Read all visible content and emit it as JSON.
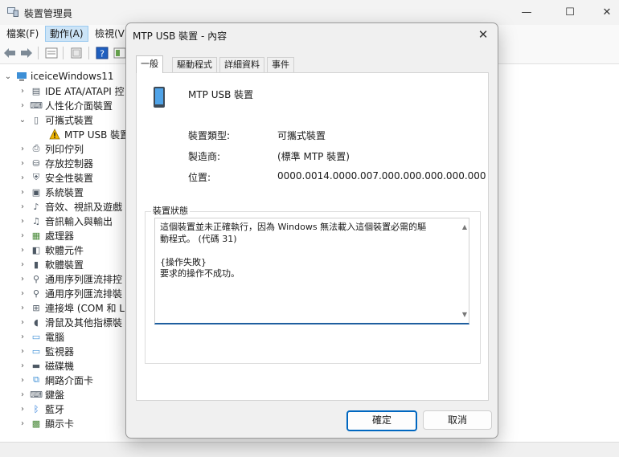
{
  "window": {
    "title": "裝置管理員",
    "controls": {
      "minimize": "—",
      "maximize": "☐",
      "close": "✕"
    }
  },
  "menu": [
    {
      "label": "檔案(F)",
      "active": false
    },
    {
      "label": "動作(A)",
      "active": true
    },
    {
      "label": "檢視(V)",
      "active": false
    }
  ],
  "toolbar": {
    "icons": [
      "back-arrow-icon",
      "forward-arrow-icon",
      "properties-icon",
      "update-icon",
      "help-icon",
      "show-hidden-icon"
    ]
  },
  "tree": {
    "root": "iceiceWindows11",
    "nodes": [
      {
        "label": "IDE ATA/ATAPI 控",
        "expanded": false,
        "icon": "ide-controller-icon"
      },
      {
        "label": "人性化介面裝置",
        "expanded": false,
        "icon": "hid-icon"
      },
      {
        "label": "可攜式裝置",
        "expanded": true,
        "icon": "portable-device-icon",
        "children": [
          {
            "label": "MTP USB 裝置",
            "warning": true
          }
        ]
      },
      {
        "label": "列印佇列",
        "expanded": false,
        "icon": "printer-icon"
      },
      {
        "label": "存放控制器",
        "expanded": false,
        "icon": "storage-controller-icon"
      },
      {
        "label": "安全性裝置",
        "expanded": false,
        "icon": "security-device-icon"
      },
      {
        "label": "系統裝置",
        "expanded": false,
        "icon": "system-device-icon"
      },
      {
        "label": "音效、視訊及遊戲",
        "expanded": false,
        "icon": "sound-icon"
      },
      {
        "label": "音訊輸入與輸出",
        "expanded": false,
        "icon": "audio-io-icon"
      },
      {
        "label": "處理器",
        "expanded": false,
        "icon": "processor-icon"
      },
      {
        "label": "軟體元件",
        "expanded": false,
        "icon": "software-component-icon"
      },
      {
        "label": "軟體裝置",
        "expanded": false,
        "icon": "software-device-icon"
      },
      {
        "label": "通用序列匯流排控",
        "expanded": false,
        "icon": "usb-controller-icon"
      },
      {
        "label": "通用序列匯流排裝",
        "expanded": false,
        "icon": "usb-device-icon"
      },
      {
        "label": "連接埠 (COM 和 L",
        "expanded": false,
        "icon": "port-icon"
      },
      {
        "label": "滑鼠及其他指標裝",
        "expanded": false,
        "icon": "mouse-icon"
      },
      {
        "label": "電腦",
        "expanded": false,
        "icon": "computer-icon"
      },
      {
        "label": "監視器",
        "expanded": false,
        "icon": "monitor-icon"
      },
      {
        "label": "磁碟機",
        "expanded": false,
        "icon": "disk-drive-icon"
      },
      {
        "label": "網路介面卡",
        "expanded": false,
        "icon": "network-adapter-icon"
      },
      {
        "label": "鍵盤",
        "expanded": false,
        "icon": "keyboard-icon"
      },
      {
        "label": "藍牙",
        "expanded": false,
        "icon": "bluetooth-icon"
      },
      {
        "label": "顯示卡",
        "expanded": false,
        "icon": "display-adapter-icon"
      }
    ]
  },
  "dialog": {
    "title": "MTP USB 裝置 - 內容",
    "close": "✕",
    "tabs": [
      "一般",
      "驅動程式",
      "詳細資料",
      "事件"
    ],
    "active_tab": 0,
    "device_name": "MTP USB 裝置",
    "properties": [
      {
        "label": "裝置類型:",
        "value": "可攜式裝置"
      },
      {
        "label": "製造商:",
        "value": "(標準 MTP 裝置)"
      },
      {
        "label": "位置:",
        "value": "0000.0014.0000.007.000.000.000.000.000"
      }
    ],
    "status_group_label": "裝置狀態",
    "status_text": "這個裝置並未正確執行，因為 Windows 無法載入這個裝置必需的驅\n動程式。 (代碼 31)\n\n{操作失敗}\n要求的操作不成功。",
    "buttons": {
      "ok": "確定",
      "cancel": "取消"
    }
  },
  "colors": {
    "accent": "#0067c0",
    "menu_active": "#cce4f7",
    "warning": "#f2b600"
  }
}
